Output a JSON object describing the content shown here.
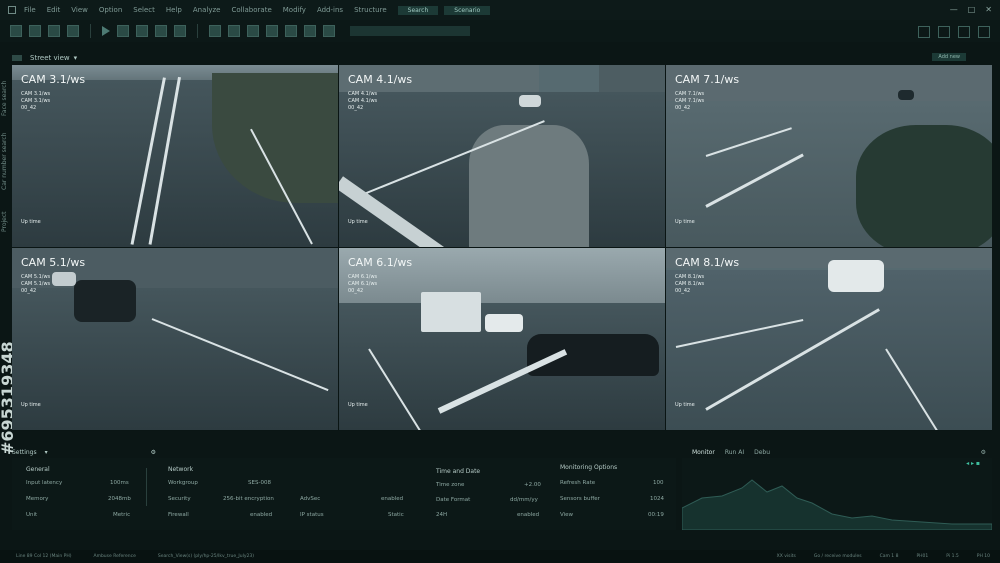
{
  "menu": {
    "items": [
      "File",
      "Edit",
      "View",
      "Option",
      "Select",
      "Help",
      "Analyze",
      "Collaborate",
      "Modify",
      "Add-ins",
      "Structure"
    ],
    "tags": [
      "Search",
      "Scenario"
    ]
  },
  "sidebar": {
    "tabs": [
      "Face search",
      "Car number search",
      "Project"
    ],
    "stock_id": "#695319348"
  },
  "street_view": {
    "title": "Street view",
    "add_label": "Add new"
  },
  "cameras": [
    {
      "title": "CAM 3.1/ws",
      "sub1": "CAM 3.1/ws",
      "sub2": "CAM 3.1/ws",
      "sub3": "00_42",
      "uptime": "Up time"
    },
    {
      "title": "CAM 4.1/ws",
      "sub1": "CAM 4.1/ws",
      "sub2": "CAM 4.1/ws",
      "sub3": "00_42",
      "uptime": "Up time"
    },
    {
      "title": "CAM 7.1/ws",
      "sub1": "CAM 7.1/ws",
      "sub2": "CAM 7.1/ws",
      "sub3": "00_42",
      "uptime": "Up time"
    },
    {
      "title": "CAM 5.1/ws",
      "sub1": "CAM 5.1/ws",
      "sub2": "CAM 5.1/ws",
      "sub3": "00_42",
      "uptime": "Up time"
    },
    {
      "title": "CAM 6.1/ws",
      "sub1": "CAM 6.1/ws",
      "sub2": "CAM 6.1/ws",
      "sub3": "00_42",
      "uptime": "Up time"
    },
    {
      "title": "CAM 8.1/ws",
      "sub1": "CAM 8.1/ws",
      "sub2": "CAM 8.1/ws",
      "sub3": "00_42",
      "uptime": "Up time"
    }
  ],
  "settings": {
    "title": "Settings",
    "general": {
      "heading": "General",
      "rows": [
        {
          "label": "Input latency",
          "value": "100ms"
        },
        {
          "label": "Memory",
          "value": "2048mb"
        },
        {
          "label": "Unit",
          "value": "Metric"
        }
      ]
    },
    "network": {
      "heading": "Network",
      "rows": [
        {
          "label": "Workgroup",
          "value": "SES-008"
        },
        {
          "label": "Security",
          "value": "256-bit encryption"
        },
        {
          "label": "Firewall",
          "value": "enabled"
        }
      ],
      "rows2": [
        {
          "label": "AdvSec",
          "value": "enabled"
        },
        {
          "label": "IP status",
          "value": "Static"
        }
      ]
    },
    "time": {
      "heading": "Time and Date",
      "rows": [
        {
          "label": "Time zone",
          "value": "+2.00"
        },
        {
          "label": "Date Format",
          "value": "dd/mm/yy"
        },
        {
          "label": "24H",
          "value": "enabled"
        }
      ]
    },
    "monitoring": {
      "heading": "Monitoring Options",
      "rows": [
        {
          "label": "Refresh Rate",
          "value": "100"
        },
        {
          "label": "Sensors buffer",
          "value": "1024"
        },
        {
          "label": "View",
          "value": "00:19"
        }
      ]
    }
  },
  "monitor": {
    "tabs": [
      "Monitor",
      "Run AI",
      "Debu"
    ]
  },
  "status": {
    "left": [
      "Line 89 Col 12 (Main PH)",
      "Ambuse Reference",
      "Search_View(s) (ply/hp-25/lkv_true_July23)"
    ],
    "right": [
      "XX visits",
      "Go / receive modules",
      "Cam 1 8",
      "PH01",
      "Pi 1.5",
      "PH 10"
    ]
  }
}
